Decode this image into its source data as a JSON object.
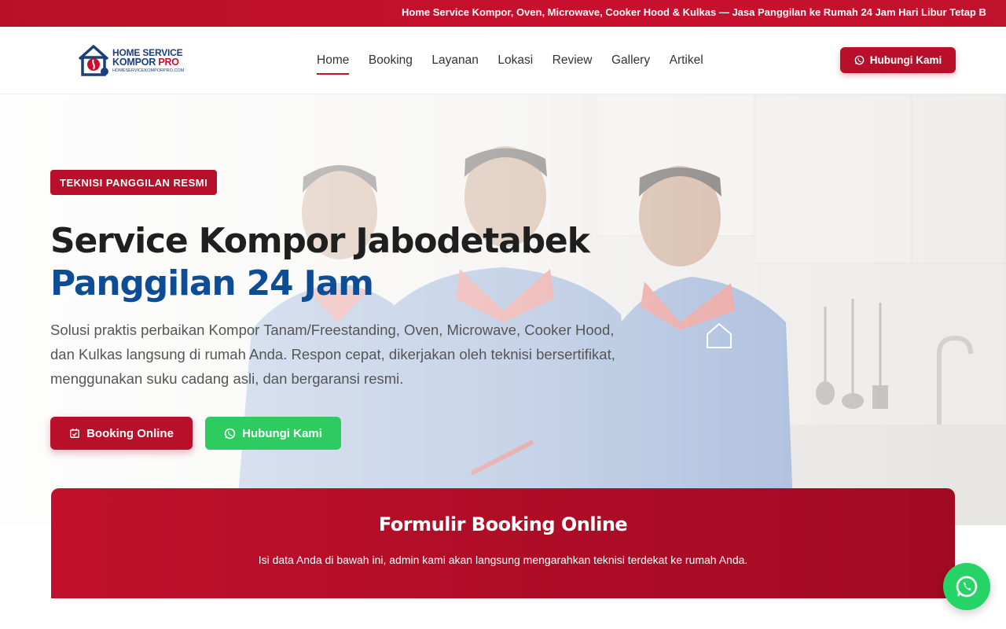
{
  "ticker": {
    "text": "Home Service Kompor, Oven, Microwave, Cooker Hood & Kulkas — Jasa Panggilan ke Rumah 24 Jam Hari Libur Tetap B"
  },
  "logo": {
    "line1": "HOME SERVICE",
    "line2_a": "KOMPOR ",
    "line2_b": "PRO",
    "line3": "HOMESERVICEKOMPORPRO.COM"
  },
  "nav": {
    "items": [
      "Home",
      "Booking",
      "Layanan",
      "Lokasi",
      "Review",
      "Gallery",
      "Artikel"
    ],
    "active": "Home",
    "cta_label": "Hubungi Kami"
  },
  "hero": {
    "badge": "TEKNISI PANGGILAN RESMI",
    "title_line1": "Service Kompor Jabodetabek",
    "title_line2": "Panggilan 24 Jam",
    "description": "Solusi praktis perbaikan Kompor Tanam/Freestanding, Oven, Microwave, Cooker Hood, dan Kulkas langsung di rumah Anda. Respon cepat, dikerjakan oleh teknisi bersertifikat, menggunakan suku cadang asli, dan bergaransi resmi.",
    "btn_booking": "Booking Online",
    "btn_hubungi": "Hubungi Kami"
  },
  "form": {
    "title": "Formulir Booking Online",
    "subtitle": "Isi data Anda di bawah ini, admin kami akan langsung mengarahkan teknisi terdekat ke rumah Anda."
  },
  "colors": {
    "brand_red": "#b8102a",
    "brand_blue": "#0d4d96",
    "whatsapp_green": "#2ecc60"
  },
  "icons": {
    "logo": "house-wrench-logo-icon",
    "whatsapp": "whatsapp-icon",
    "calendar": "calendar-check-icon"
  }
}
